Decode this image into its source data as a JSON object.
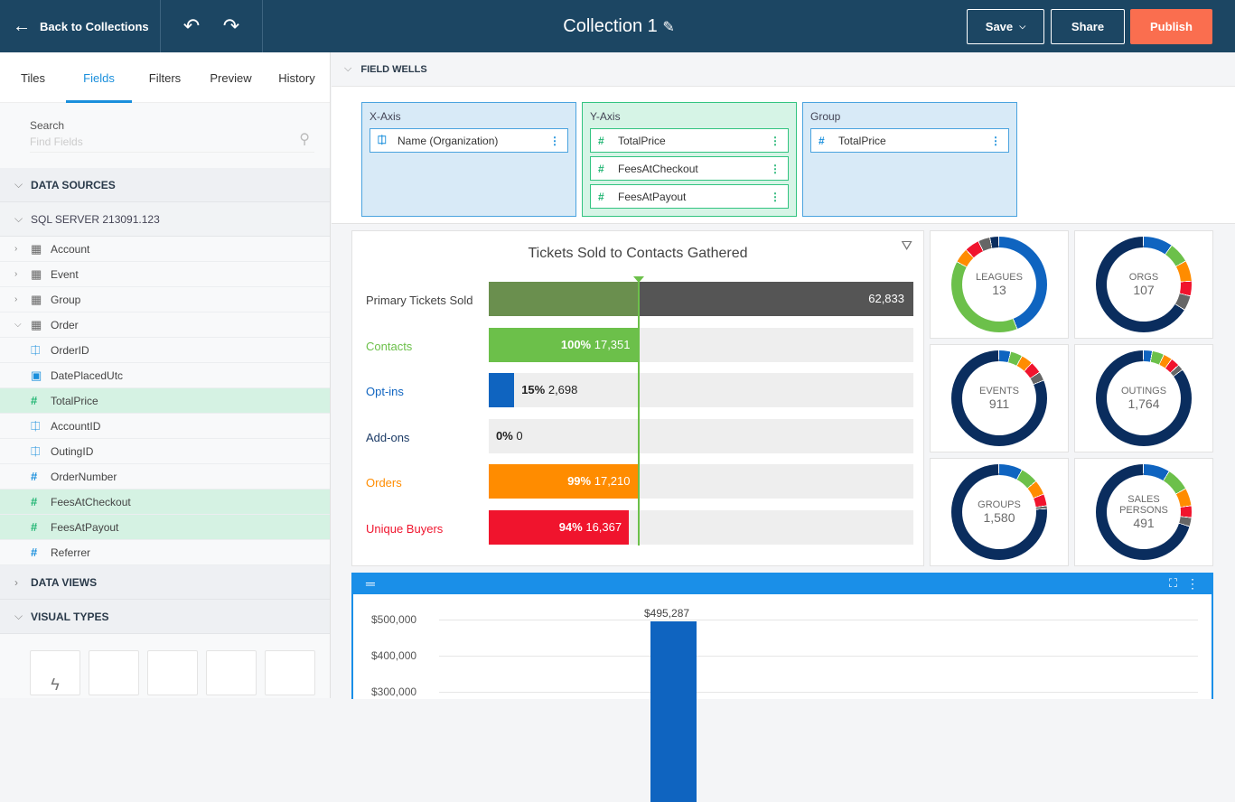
{
  "header": {
    "back_label": "Back to Collections",
    "title": "Collection 1",
    "save": "Save",
    "share": "Share",
    "publish": "Publish"
  },
  "sidebar": {
    "tabs": [
      "Tiles",
      "Fields",
      "Filters",
      "Preview",
      "History"
    ],
    "search_label": "Search",
    "search_placeholder": "Find Fields",
    "data_sources": "DATA SOURCES",
    "server": "SQL SERVER 213091.123",
    "tables": [
      "Account",
      "Event",
      "Group",
      "Order"
    ],
    "fields": [
      {
        "name": "OrderID",
        "type": "text",
        "hl": false
      },
      {
        "name": "DatePlacedUtc",
        "type": "date",
        "hl": false
      },
      {
        "name": "TotalPrice",
        "type": "number",
        "hl": true
      },
      {
        "name": "AccountID",
        "type": "text",
        "hl": false
      },
      {
        "name": "OutingID",
        "type": "text",
        "hl": false
      },
      {
        "name": "OrderNumber",
        "type": "number",
        "hl": false
      },
      {
        "name": "FeesAtCheckout",
        "type": "number",
        "hl": true
      },
      {
        "name": "FeesAtPayout",
        "type": "number",
        "hl": true
      },
      {
        "name": "Referrer",
        "type": "number",
        "hl": false
      }
    ],
    "data_views": "DATA VIEWS",
    "visual_types": "VISUAL TYPES"
  },
  "field_wells": {
    "title": "FIELD WELLS",
    "x_axis": {
      "label": "X-Axis",
      "items": [
        "Name (Organization)"
      ]
    },
    "y_axis": {
      "label": "Y-Axis",
      "items": [
        "TotalPrice",
        "FeesAtCheckout",
        "FeesAtPayout"
      ]
    },
    "group": {
      "label": "Group",
      "items": [
        "TotalPrice"
      ]
    }
  },
  "funnel": {
    "title": "Tickets Sold to Contacts Gathered",
    "rows": [
      {
        "label": "Primary Tickets Sold",
        "pct": "",
        "value": "62,833",
        "fraction": 1.0,
        "color": "#555555",
        "labelColor": "#444444"
      },
      {
        "label": "Contacts",
        "pct": "100%",
        "value": "17,351",
        "fraction": 0.35,
        "color": "#6cc04a",
        "labelColor": "#6cc04a"
      },
      {
        "label": "Opt-ins",
        "pct": "15%",
        "value": "2,698",
        "fraction": 0.06,
        "color": "#0f64c0",
        "labelColor": "#0f64c0"
      },
      {
        "label": "Add-ons",
        "pct": "0%",
        "value": "0",
        "fraction": 0,
        "color": "#1c3b66",
        "labelColor": "#1c3b66"
      },
      {
        "label": "Orders",
        "pct": "99%",
        "value": "17,210",
        "fraction": 0.35,
        "color": "#ff8c00",
        "labelColor": "#ff8c00"
      },
      {
        "label": "Unique Buyers",
        "pct": "94%",
        "value": "16,367",
        "fraction": 0.33,
        "color": "#f0142d",
        "labelColor": "#f0142d"
      }
    ],
    "target_fraction": 0.35
  },
  "donuts": [
    {
      "name": "LEAGUES",
      "value": "13",
      "segments": [
        [
          0.44,
          "#0f64c0"
        ],
        [
          0.39,
          "#6cc04a"
        ],
        [
          0.05,
          "#ff8c00"
        ],
        [
          0.05,
          "#f0142d"
        ],
        [
          0.04,
          "#666666"
        ],
        [
          0.03,
          "#0a2d5e"
        ]
      ]
    },
    {
      "name": "ORGS",
      "value": "107",
      "segments": [
        [
          0.1,
          "#0f64c0"
        ],
        [
          0.07,
          "#6cc04a"
        ],
        [
          0.07,
          "#ff8c00"
        ],
        [
          0.05,
          "#f0142d"
        ],
        [
          0.05,
          "#666666"
        ],
        [
          0.66,
          "#0a2d5e"
        ]
      ]
    },
    {
      "name": "EVENTS",
      "value": "911",
      "segments": [
        [
          0.04,
          "#0f64c0"
        ],
        [
          0.04,
          "#6cc04a"
        ],
        [
          0.04,
          "#ff8c00"
        ],
        [
          0.04,
          "#f0142d"
        ],
        [
          0.03,
          "#666666"
        ],
        [
          0.81,
          "#0a2d5e"
        ]
      ]
    },
    {
      "name": "OUTINGS",
      "value": "1,764",
      "segments": [
        [
          0.03,
          "#0f64c0"
        ],
        [
          0.04,
          "#6cc04a"
        ],
        [
          0.03,
          "#ff8c00"
        ],
        [
          0.03,
          "#f0142d"
        ],
        [
          0.02,
          "#666666"
        ],
        [
          0.85,
          "#0a2d5e"
        ]
      ]
    },
    {
      "name": "GROUPS",
      "value": "1,580",
      "segments": [
        [
          0.08,
          "#0f64c0"
        ],
        [
          0.06,
          "#6cc04a"
        ],
        [
          0.05,
          "#ff8c00"
        ],
        [
          0.04,
          "#f0142d"
        ],
        [
          0.01,
          "#666666"
        ],
        [
          0.76,
          "#0a2d5e"
        ]
      ]
    },
    {
      "name": "SALES PERSONS",
      "value": "491",
      "segments": [
        [
          0.09,
          "#0f64c0"
        ],
        [
          0.08,
          "#6cc04a"
        ],
        [
          0.06,
          "#ff8c00"
        ],
        [
          0.04,
          "#f0142d"
        ],
        [
          0.03,
          "#666666"
        ],
        [
          0.7,
          "#0a2d5e"
        ]
      ]
    }
  ],
  "chart_data": {
    "type": "bar",
    "ylabels": [
      "$500,000",
      "$400,000",
      "$300,000"
    ],
    "bars": [
      {
        "value": 495287,
        "label": "$495,287"
      }
    ]
  }
}
